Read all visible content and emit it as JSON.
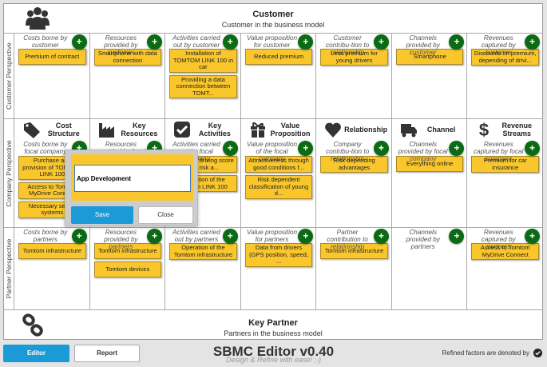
{
  "customer_band": {
    "title": "Customer",
    "subtitle": "Customer in the business model"
  },
  "partner_band": {
    "title": "Key Partner",
    "subtitle": "Partners in the business model"
  },
  "rows": [
    {
      "label": "Customer Perspective",
      "cells": [
        {
          "header": "Costs borne by customer",
          "cards": [
            "Premium of contract"
          ]
        },
        {
          "header": "Resources provided by customer",
          "cards": [
            "Smartphone with data connection"
          ]
        },
        {
          "header": "Activities carried out by customer",
          "cards": [
            "Installation of TOMTOM LINK 100 in car",
            "Providing a data connection between TOMT..."
          ]
        },
        {
          "header": "Value proposition for customer",
          "cards": [
            "Reduced premium"
          ]
        },
        {
          "header": "Customer contribu-tion to relationship",
          "cards": [
            "Less premium for young drivers"
          ]
        },
        {
          "header": "Channels provided by customer",
          "cards": [
            "Smartphone"
          ]
        },
        {
          "header": "Revenues captured by customer",
          "cards": [
            "Discounts on premium, depending of drivi..."
          ]
        }
      ]
    },
    {
      "label": "Company Perspective",
      "cells": [
        {
          "title": "Cost Structure",
          "icon": "tags-icon",
          "header": "Costs borne by focal company",
          "cards": [
            "Purchase and provision of TOMTOM LINK 100",
            "Access to Tomtom MyDrive Connect",
            "Necessary server systems"
          ]
        },
        {
          "title": "Key Resources",
          "icon": "factory-icon",
          "header": "Resources provided by focal company",
          "cards": []
        },
        {
          "title": "Key Activities",
          "icon": "checkbox-icon",
          "header": "Activities carried out by focal company",
          "cards": [
            "Calculate driving score and risk a...",
            "Operation of the Tomtom LINK 100"
          ]
        },
        {
          "title": "Value Proposition",
          "icon": "gift-icon",
          "header": "Value proposition of the focal company",
          "cards": [
            "Attractiveness through good conditions f...",
            "Risk dependent classification of young d..."
          ]
        },
        {
          "title": "Relationship",
          "icon": "heart-icon",
          "header": "Company contribu-tion to relationship",
          "cards": [
            "Risk depending advantages"
          ]
        },
        {
          "title": "Channel",
          "icon": "truck-icon",
          "header": "Channels provided by focal company",
          "cards": [
            "Everything online"
          ]
        },
        {
          "title": "Revenue Streams",
          "icon": "dollar-icon",
          "header": "Revenues captured by focal company",
          "cards": [
            "Premium for car insurance"
          ]
        }
      ]
    },
    {
      "label": "Partner Perspective",
      "cells": [
        {
          "header": "Costs borne by partners",
          "cards": [
            "Tomtom infrastructure"
          ]
        },
        {
          "header": "Resources provided by partners",
          "cards": [
            "Tomtom infrastructure",
            "Tomtom devices"
          ]
        },
        {
          "header": "Activities carried out by partners",
          "cards": [
            "Operation of the Tomtom infrastructure"
          ]
        },
        {
          "header": "Value proposition for partners",
          "cards": [
            "Data from drivers (GPS position, speed, ..."
          ]
        },
        {
          "header": "Partner contribution to relationship",
          "cards": [
            "Tomtom infrastructure"
          ]
        },
        {
          "header": "Channels provided by partners",
          "cards": []
        },
        {
          "header": "Revenues captured by partners",
          "cards": [
            "Access to Tomtom MyDrive Connect"
          ]
        }
      ]
    }
  ],
  "plus_label": "+",
  "dialog": {
    "value": "App Development",
    "save": "Save",
    "close": "Close"
  },
  "footer": {
    "editor": "Editor",
    "report": "Report",
    "title": "SBMC Editor v0.40",
    "subtitle": "Design & Refine with ease! ;-)",
    "refined_note": "Refined factors are denoted by"
  },
  "colors": {
    "card": "#f9c72b",
    "plus": "#0b6b14",
    "primary": "#1a9ad6"
  }
}
